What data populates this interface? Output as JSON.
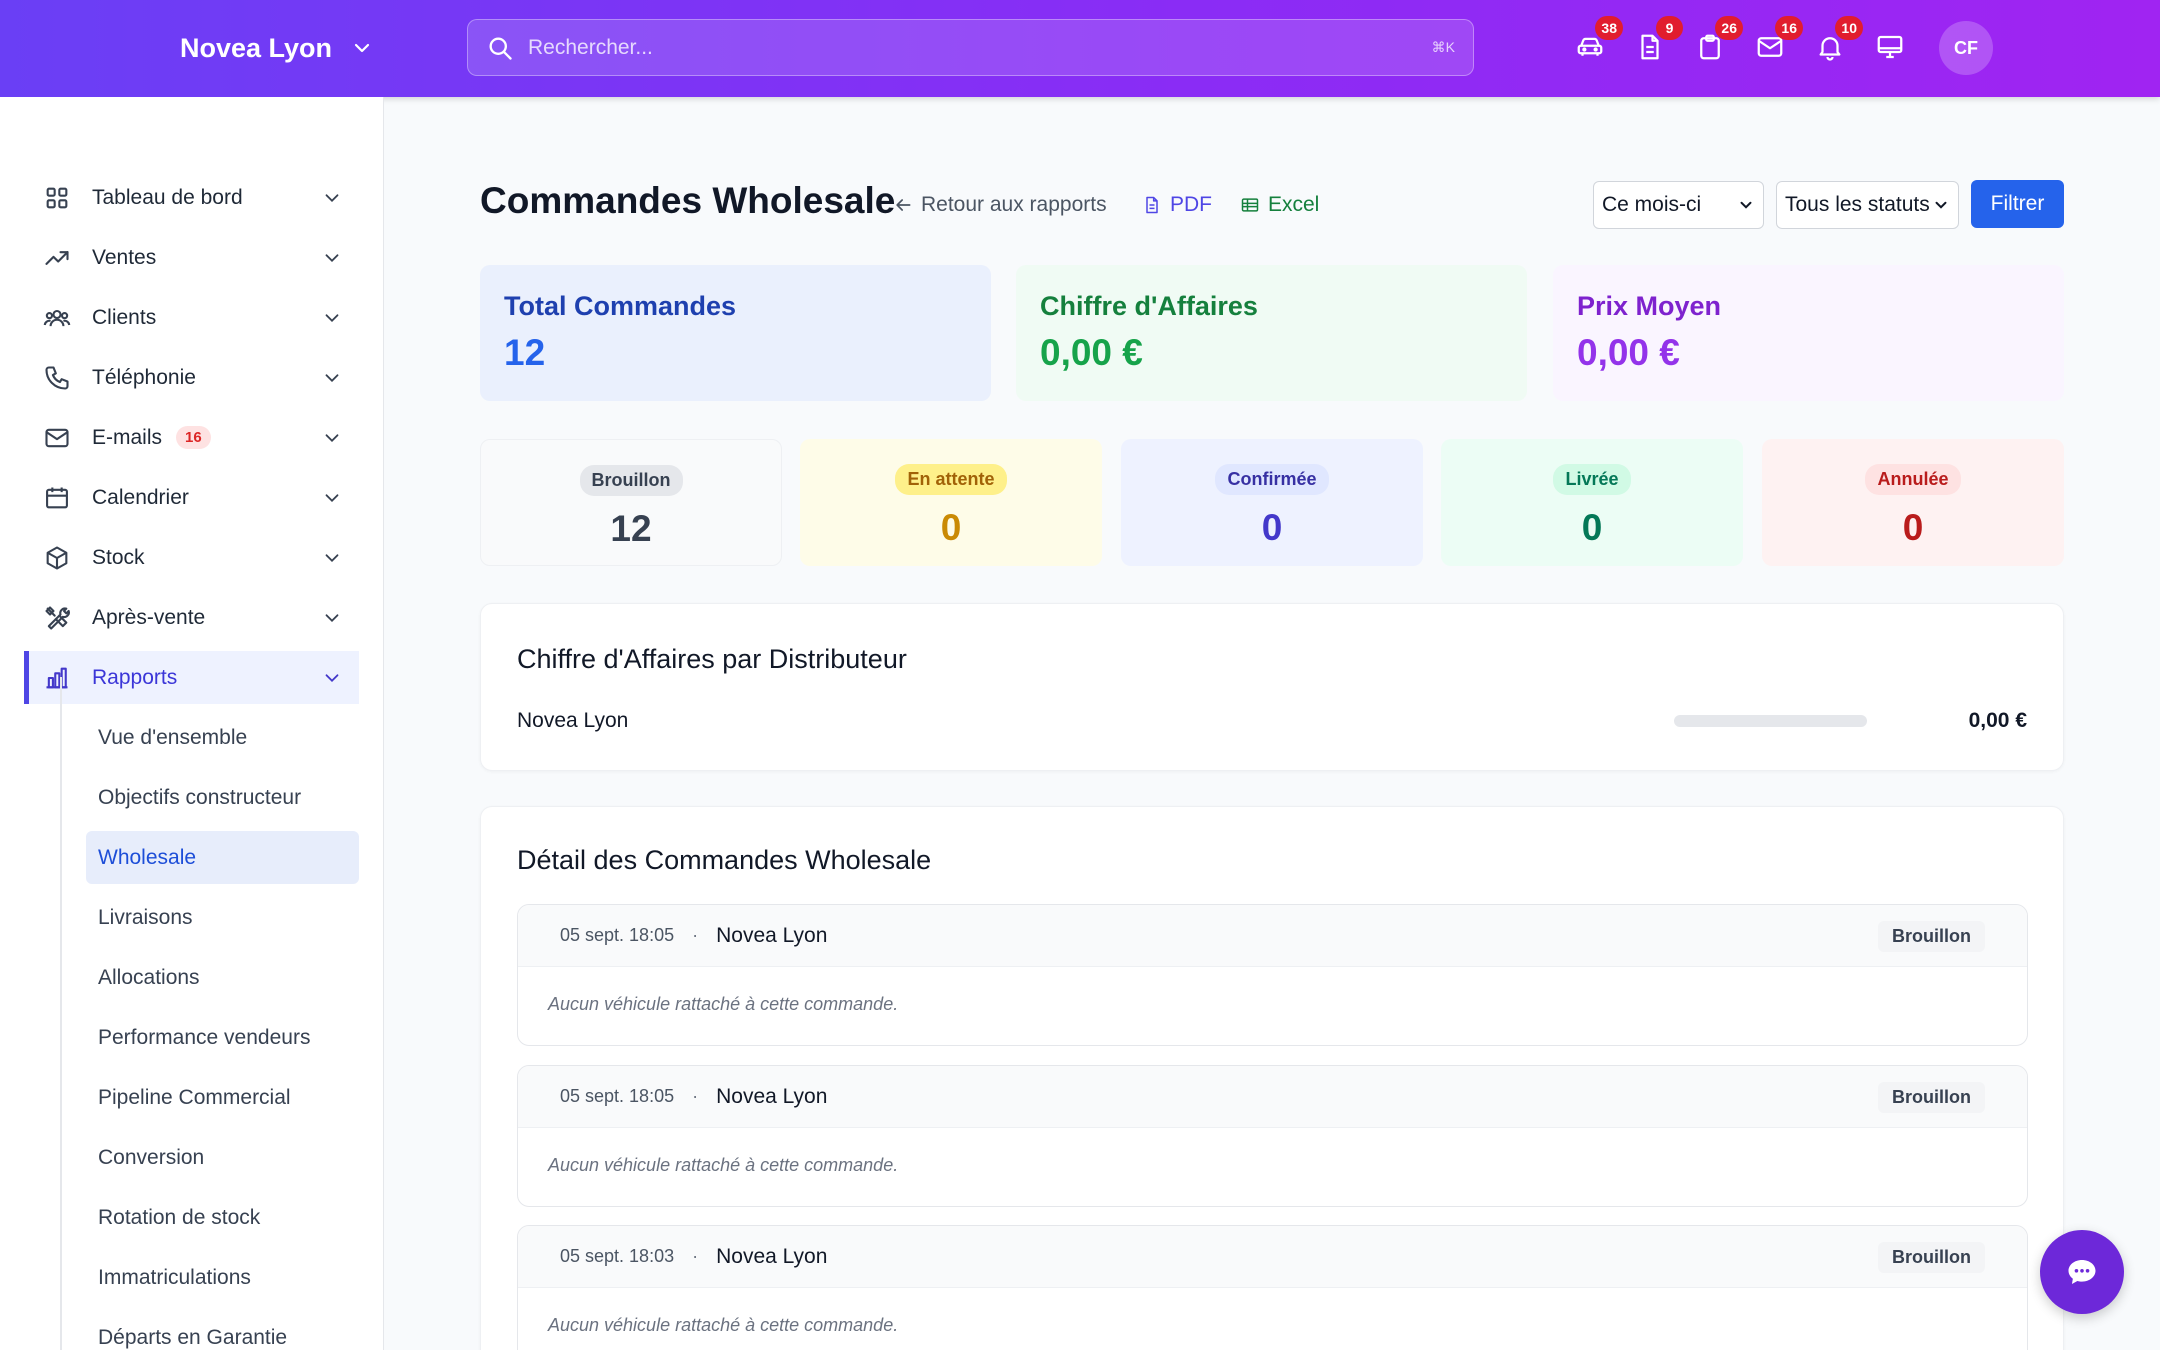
{
  "header": {
    "brand": "Novea Lyon",
    "search_placeholder": "Rechercher...",
    "search_shortcut": "⌘K",
    "icons": [
      {
        "name": "car-icon",
        "badge": "38"
      },
      {
        "name": "document-icon",
        "badge": "9"
      },
      {
        "name": "clipboard-icon",
        "badge": "26"
      },
      {
        "name": "mail-icon",
        "badge": "16"
      },
      {
        "name": "bell-icon",
        "badge": "10"
      },
      {
        "name": "monitor-icon",
        "badge": ""
      }
    ],
    "avatar": "CF"
  },
  "sidebar": {
    "items": [
      {
        "label": "Tableau de bord",
        "icon": "grid-icon"
      },
      {
        "label": "Ventes",
        "icon": "trend-icon"
      },
      {
        "label": "Clients",
        "icon": "users-icon"
      },
      {
        "label": "Téléphonie",
        "icon": "phone-icon"
      },
      {
        "label": "E-mails",
        "icon": "mail-icon",
        "badge": "16"
      },
      {
        "label": "Calendrier",
        "icon": "calendar-icon"
      },
      {
        "label": "Stock",
        "icon": "box-icon"
      },
      {
        "label": "Après-vente",
        "icon": "tools-icon"
      },
      {
        "label": "Rapports",
        "icon": "chart-icon"
      }
    ],
    "sub_items": [
      "Vue d'ensemble",
      "Objectifs constructeur",
      "Wholesale",
      "Livraisons",
      "Allocations",
      "Performance vendeurs",
      "Pipeline Commercial",
      "Conversion",
      "Rotation de stock",
      "Immatriculations",
      "Départs en Garantie"
    ]
  },
  "page": {
    "title": "Commandes Wholesale",
    "back_link": "Retour aux rapports",
    "pdf": "PDF",
    "excel": "Excel",
    "period_select": "Ce mois-ci",
    "status_select": "Tous les statuts",
    "filter_button": "Filtrer"
  },
  "kpis": [
    {
      "label": "Total Commandes",
      "value": "12"
    },
    {
      "label": "Chiffre d'Affaires",
      "value": "0,00 €"
    },
    {
      "label": "Prix Moyen",
      "value": "0,00 €"
    }
  ],
  "statuses": [
    {
      "label": "Brouillon",
      "value": "12"
    },
    {
      "label": "En attente",
      "value": "0"
    },
    {
      "label": "Confirmée",
      "value": "0"
    },
    {
      "label": "Livrée",
      "value": "0"
    },
    {
      "label": "Annulée",
      "value": "0"
    }
  ],
  "distributors": {
    "title": "Chiffre d'Affaires par Distributeur",
    "rows": [
      {
        "name": "Novea Lyon",
        "value": "0,00 €",
        "share": 0
      }
    ]
  },
  "orders": {
    "title": "Détail des Commandes Wholesale",
    "items": [
      {
        "date": "05 sept. 18:05",
        "distributor": "Novea Lyon",
        "status": "Brouillon",
        "note": "Aucun véhicule rattaché à cette commande."
      },
      {
        "date": "05 sept. 18:05",
        "distributor": "Novea Lyon",
        "status": "Brouillon",
        "note": "Aucun véhicule rattaché à cette commande."
      },
      {
        "date": "05 sept. 18:03",
        "distributor": "Novea Lyon",
        "status": "Brouillon",
        "note": "Aucun véhicule rattaché à cette commande."
      }
    ]
  },
  "colors": {
    "header_start": "#6a3ff5",
    "header_end": "#a024f2",
    "primary": "#2563eb",
    "accent": "#4f46e5"
  }
}
